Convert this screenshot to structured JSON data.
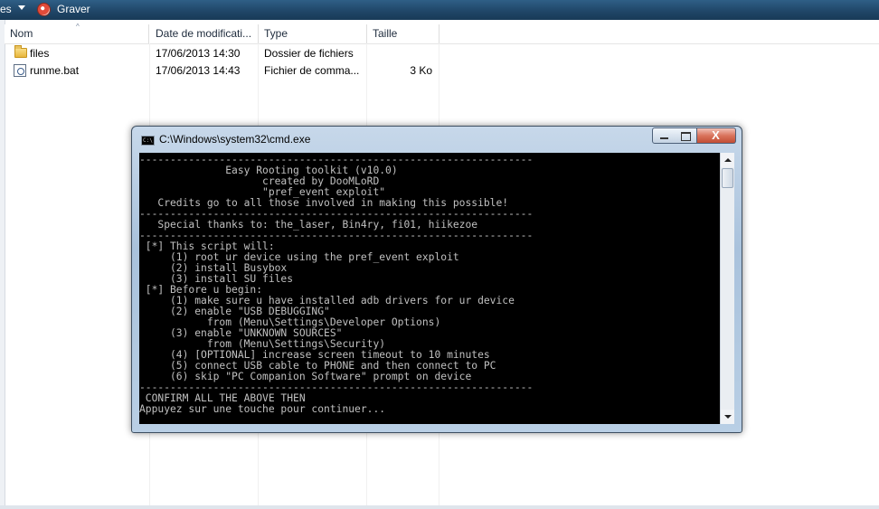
{
  "toolbar": {
    "partial_label": "es",
    "burn_label": "Graver"
  },
  "list": {
    "columns": [
      "Nom",
      "Date de modificati...",
      "Type",
      "Taille"
    ],
    "rows": [
      {
        "icon": "folder-icon",
        "name": "files",
        "date": "17/06/2013 14:30",
        "type": "Dossier de fichiers",
        "size": ""
      },
      {
        "icon": "batch-file-icon",
        "name": "runme.bat",
        "date": "17/06/2013 14:43",
        "type": "Fichier de comma...",
        "size": "3 Ko"
      }
    ]
  },
  "cmd": {
    "title": "C:\\Windows\\system32\\cmd.exe",
    "icon_text": "C:\\",
    "close_label": "X",
    "lines": [
      "----------------------------------------------------------------",
      "              Easy Rooting toolkit (v10.0)",
      "                    created by DooMLoRD",
      "                    \"pref_event exploit\"",
      "   Credits go to all those involved in making this possible!",
      "----------------------------------------------------------------",
      "   Special thanks to: the_laser, Bin4ry, fi01, hiikezoe",
      "----------------------------------------------------------------",
      " [*] This script will:",
      "     (1) root ur device using the pref_event exploit",
      "     (2) install Busybox",
      "     (3) install SU files",
      " [*] Before u begin:",
      "     (1) make sure u have installed adb drivers for ur device",
      "     (2) enable \"USB DEBUGGING\"",
      "           from (Menu\\Settings\\Developer Options)",
      "     (3) enable \"UNKNOWN SOURCES\"",
      "           from (Menu\\Settings\\Security)",
      "     (4) [OPTIONAL] increase screen timeout to 10 minutes",
      "     (5) connect USB cable to PHONE and then connect to PC",
      "     (6) skip \"PC Companion Software\" prompt on device",
      "----------------------------------------------------------------",
      " CONFIRM ALL THE ABOVE THEN",
      "Appuyez sur une touche pour continuer..."
    ]
  }
}
